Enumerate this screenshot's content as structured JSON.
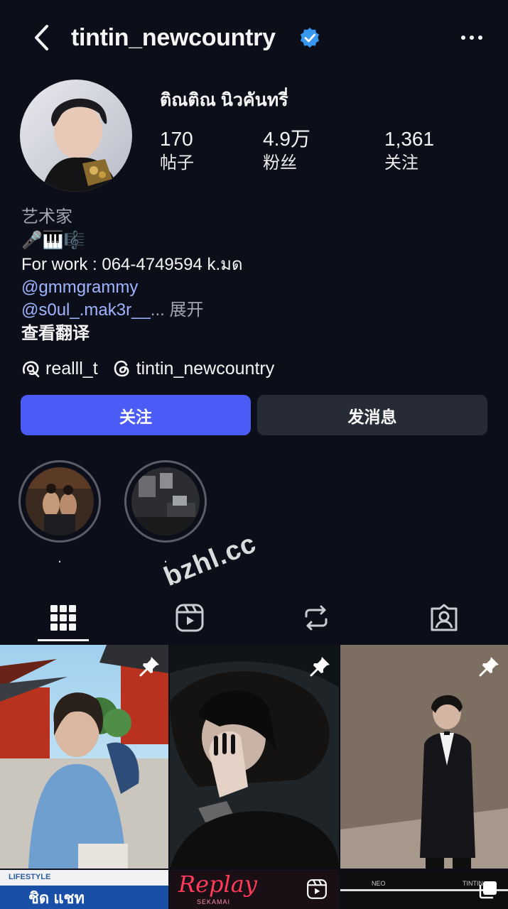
{
  "header": {
    "username": "tintin_newcountry",
    "verified": true,
    "back_icon": "chevron-left-icon",
    "more_icon": "more-horizontal-icon"
  },
  "profile": {
    "display_name": "ติณติณ นิวคันทรี่",
    "stats": [
      {
        "value": "170",
        "label": "帖子"
      },
      {
        "value": "4.9万",
        "label": "粉丝"
      },
      {
        "value": "1,361",
        "label": "关注"
      }
    ]
  },
  "bio": {
    "category": "艺术家",
    "emoji_line": "🎤🎹🎼",
    "work_line": "For work : 064-4749594 k.มด",
    "mention1": "@gmmgrammy",
    "mention2": "@s0ul_.mak3r__",
    "ellipsis": "...",
    "expand": "展开",
    "translate": "查看翻译"
  },
  "links": [
    {
      "icon": "threads-thread-icon",
      "label": "realll_t"
    },
    {
      "icon": "threads-logo-icon",
      "label": "tintin_newcountry"
    }
  ],
  "actions": {
    "follow_label": "关注",
    "message_label": "发消息"
  },
  "highlights": [
    {
      "label": "."
    },
    {
      "label": "."
    }
  ],
  "tabs": [
    {
      "icon": "grid-icon",
      "active": true
    },
    {
      "icon": "reels-icon",
      "active": false
    },
    {
      "icon": "repost-icon",
      "active": false
    },
    {
      "icon": "tagged-icon",
      "active": false
    }
  ],
  "grid_overlays": {
    "replay_text": "Replay",
    "replay_sub": "SEKAMAI",
    "bottom_left_text": "ชิด แชท",
    "bottom_left_brand": "LIFESTYLE",
    "strip_labels": [
      "NEO",
      "TINTIN"
    ]
  },
  "watermark": "bzhl.cc",
  "colors": {
    "background": "#0c0f1a",
    "follow_button": "#4a5cf5",
    "message_button": "#272b35",
    "link": "#9fb4ff",
    "verified_badge": "#3897f0"
  }
}
